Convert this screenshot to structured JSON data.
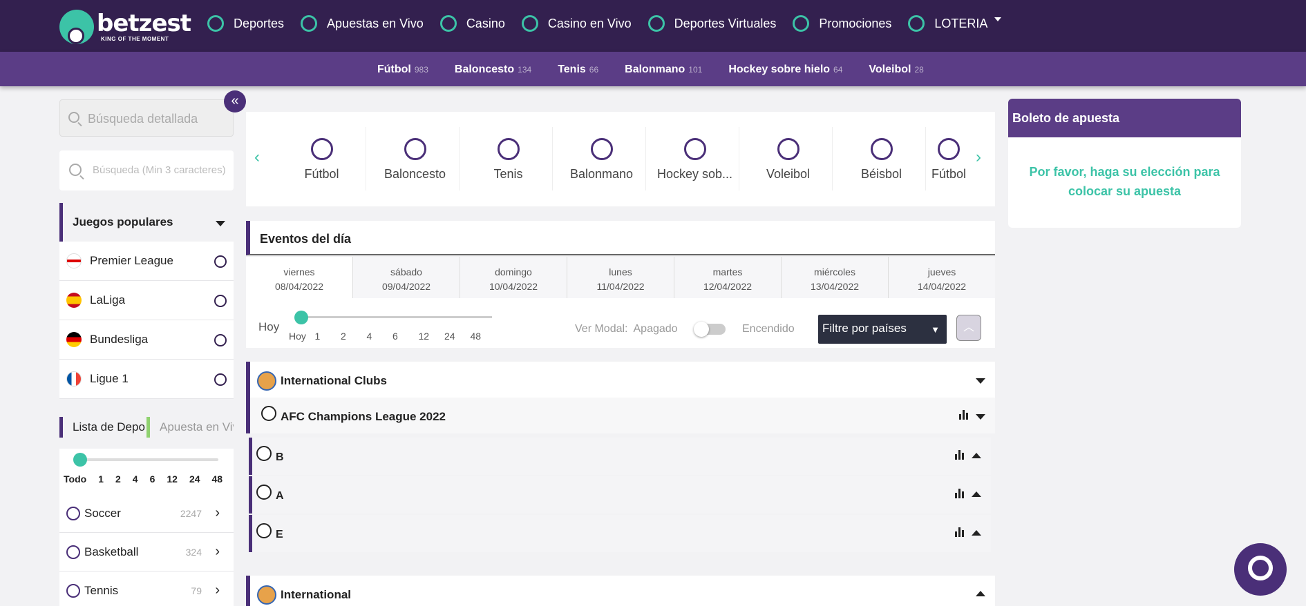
{
  "brand": {
    "name": "betzest",
    "tagline": "KING OF THE MOMENT"
  },
  "mainnav": [
    "Deportes",
    "Apuestas en Vivo",
    "Casino",
    "Casino en Vivo",
    "Deportes Virtuales",
    "Promociones",
    "LOTERIA"
  ],
  "subnav": [
    {
      "label": "Fútbol",
      "count": "983"
    },
    {
      "label": "Baloncesto",
      "count": "134"
    },
    {
      "label": "Tenis",
      "count": "66"
    },
    {
      "label": "Balonmano",
      "count": "101"
    },
    {
      "label": "Hockey sobre hielo",
      "count": "64"
    },
    {
      "label": "Voleibol",
      "count": "28"
    }
  ],
  "search": {
    "detailed_placeholder": "Búsqueda detallada",
    "min_placeholder": "Búsqueda (Min 3 caracteres)"
  },
  "popular": {
    "title": "Juegos populares",
    "items": [
      "Premier League",
      "LaLiga",
      "Bundesliga",
      "Ligue 1"
    ]
  },
  "left_tabs": {
    "sports_list": "Lista de Deportes",
    "live": "Apuesta en Vivo"
  },
  "left_slider": {
    "ticks": [
      "Todo",
      "1",
      "2",
      "4",
      "6",
      "12",
      "24",
      "48"
    ]
  },
  "sports": [
    {
      "name": "Soccer",
      "count": "2247"
    },
    {
      "name": "Basketball",
      "count": "324"
    },
    {
      "name": "Tennis",
      "count": "79"
    }
  ],
  "carousel": [
    "Fútbol",
    "Baloncesto",
    "Tenis",
    "Balonmano",
    "Hockey sob...",
    "Voleibol",
    "Béisbol",
    "Fútbol"
  ],
  "events": {
    "title": "Eventos del día",
    "days": [
      {
        "name": "viernes",
        "date": "08/04/2022"
      },
      {
        "name": "sábado",
        "date": "09/04/2022"
      },
      {
        "name": "domingo",
        "date": "10/04/2022"
      },
      {
        "name": "lunes",
        "date": "11/04/2022"
      },
      {
        "name": "martes",
        "date": "12/04/2022"
      },
      {
        "name": "miércoles",
        "date": "13/04/2022"
      },
      {
        "name": "jueves",
        "date": "14/04/2022"
      }
    ],
    "hoy": "Hoy",
    "time_ticks": [
      "Hoy",
      "1",
      "2",
      "4",
      "6",
      "12",
      "24",
      "48"
    ],
    "ver_modal": "Ver Modal:",
    "off": "Apagado",
    "on": "Encendido",
    "country_filter": "Filtre por países",
    "groups": [
      "International Clubs",
      "AFC Champions League 2022"
    ],
    "subgroups": [
      "B",
      "A",
      "E"
    ],
    "next_group": "International"
  },
  "betslip": {
    "title": "Boleto de apuesta",
    "message": "Por favor, haga su elección para colocar su apuesta"
  },
  "colors": {
    "primary": "#33204f",
    "accent": "#3cc3a7",
    "sub": "#5b3d86"
  }
}
